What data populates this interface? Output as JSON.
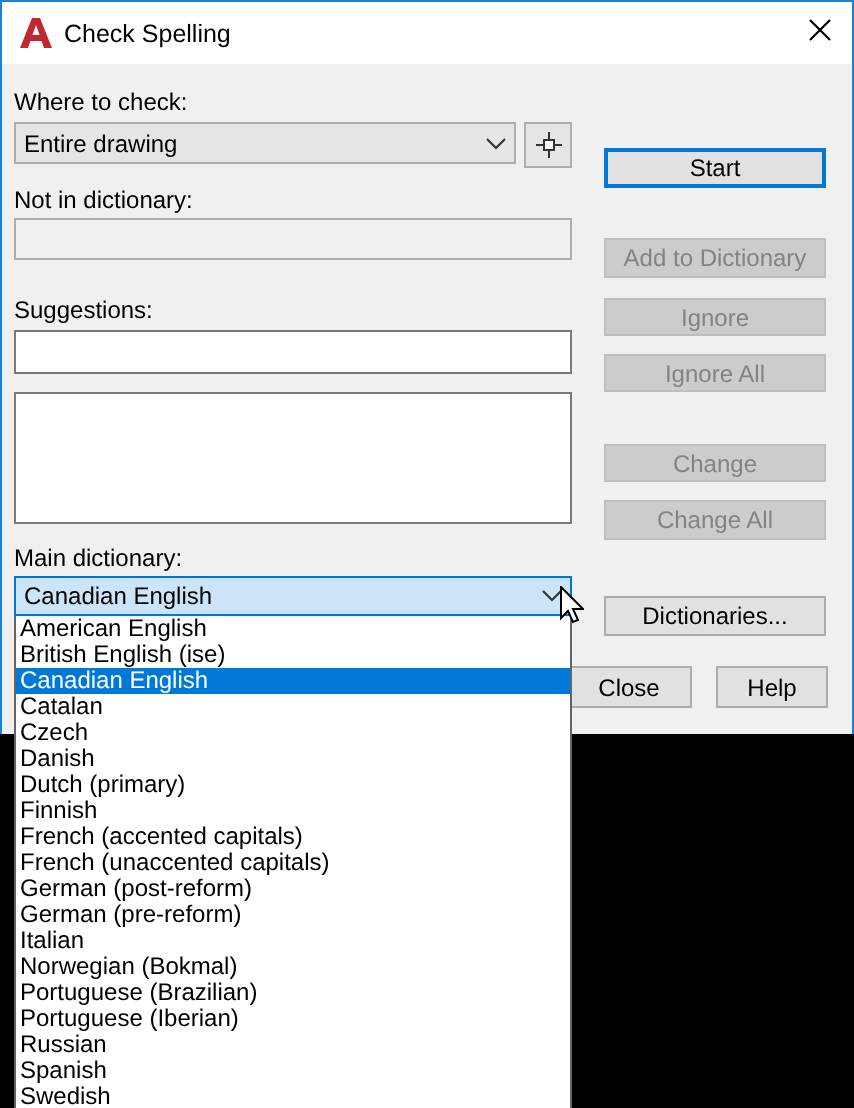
{
  "window": {
    "title": "Check Spelling"
  },
  "where_to_check": {
    "label": "Where to check:",
    "value": "Entire drawing"
  },
  "not_in_dictionary": {
    "label": "Not in dictionary:",
    "disabled": true
  },
  "suggestions": {
    "label": "Suggestions:"
  },
  "buttons": [
    {
      "label": "Start",
      "disabled": false,
      "default": true
    },
    {
      "label": "Add to Dictionary",
      "disabled": true,
      "default": false
    },
    {
      "label": "Ignore",
      "disabled": true,
      "default": false
    },
    {
      "label": "Ignore All",
      "disabled": true,
      "default": false
    },
    {
      "label": "Change",
      "disabled": true,
      "default": false
    },
    {
      "label": "Change All",
      "disabled": true,
      "default": false
    },
    {
      "label": "Dictionaries...",
      "disabled": false,
      "default": false
    }
  ],
  "main_dictionary": {
    "label": "Main dictionary:",
    "value": "Canadian English",
    "open": true,
    "options": [
      {
        "label": "American English",
        "selected": false
      },
      {
        "label": "British English (ise)",
        "selected": false
      },
      {
        "label": "Canadian English",
        "selected": true
      },
      {
        "label": "Catalan",
        "selected": false
      },
      {
        "label": "Czech",
        "selected": false
      },
      {
        "label": "Danish",
        "selected": false
      },
      {
        "label": "Dutch (primary)",
        "selected": false
      },
      {
        "label": "Finnish",
        "selected": false
      },
      {
        "label": "French (accented capitals)",
        "selected": false
      },
      {
        "label": "French (unaccented capitals)",
        "selected": false
      },
      {
        "label": "German (post-reform)",
        "selected": false
      },
      {
        "label": "German (pre-reform)",
        "selected": false
      },
      {
        "label": "Italian",
        "selected": false
      },
      {
        "label": "Norwegian (Bokmal)",
        "selected": false
      },
      {
        "label": "Portuguese (Brazilian)",
        "selected": false
      },
      {
        "label": "Portuguese (Iberian)",
        "selected": false
      },
      {
        "label": "Russian",
        "selected": false
      },
      {
        "label": "Spanish",
        "selected": false
      },
      {
        "label": "Swedish",
        "selected": false
      }
    ]
  },
  "footer_buttons": [
    {
      "label": "Close"
    },
    {
      "label": "Help"
    }
  ]
}
